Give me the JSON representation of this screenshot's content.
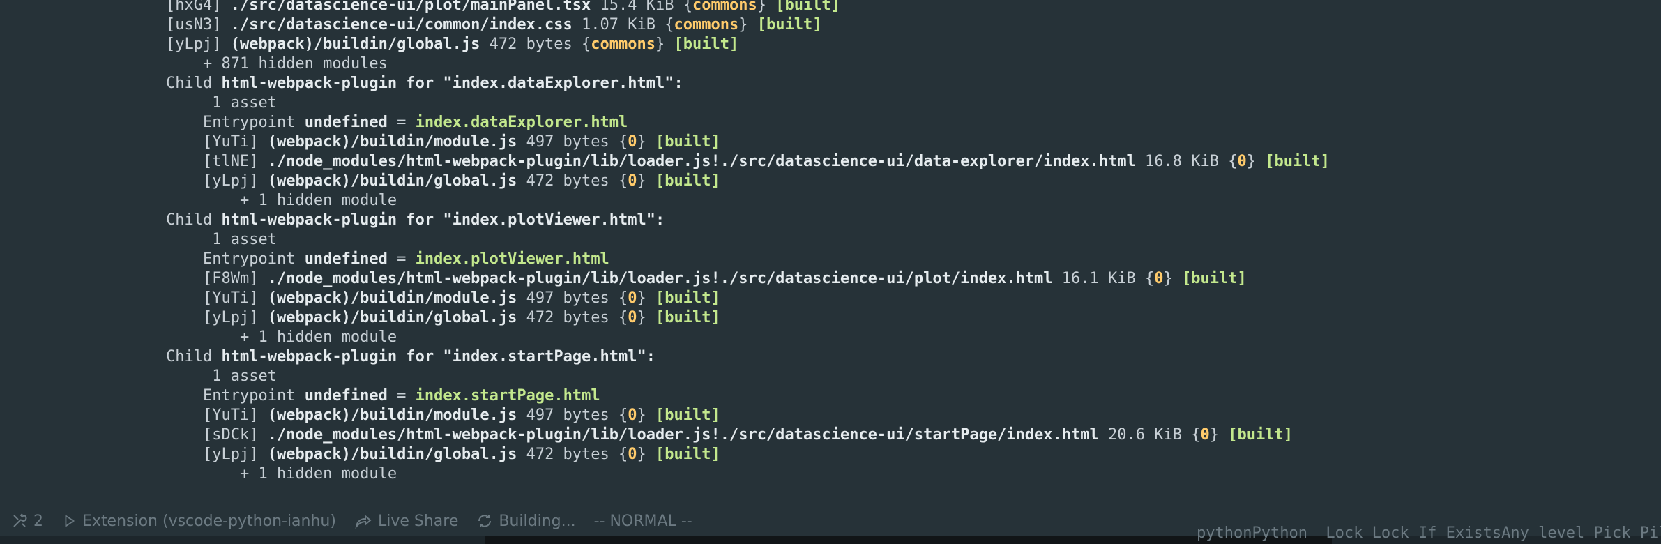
{
  "terminal": {
    "lines": [
      [
        {
          "t": "[hxG4] "
        },
        {
          "t": "./src/datascience-ui/plot/mainPanel.tsx",
          "s": "b"
        },
        {
          "t": " 15.4 KiB {"
        },
        {
          "t": "commons",
          "s": "y"
        },
        {
          "t": "} "
        },
        {
          "t": "[built]",
          "s": "g"
        }
      ],
      [
        {
          "t": "[usN3] "
        },
        {
          "t": "./src/datascience-ui/common/index.css",
          "s": "b"
        },
        {
          "t": " 1.07 KiB {"
        },
        {
          "t": "commons",
          "s": "y"
        },
        {
          "t": "} "
        },
        {
          "t": "[built]",
          "s": "g"
        }
      ],
      [
        {
          "t": "[yLpj] "
        },
        {
          "t": "(webpack)/buildin/global.js",
          "s": "b"
        },
        {
          "t": " 472 bytes {"
        },
        {
          "t": "commons",
          "s": "y"
        },
        {
          "t": "} "
        },
        {
          "t": "[built]",
          "s": "g"
        }
      ],
      [
        {
          "t": "    + 871 hidden modules"
        }
      ],
      [
        {
          "t": "Child "
        },
        {
          "t": "html-webpack-plugin",
          "s": "b"
        },
        {
          "t": " for \"index.dataExplorer.html\":",
          "s": "b"
        }
      ],
      [
        {
          "t": "     1 asset"
        }
      ],
      [
        {
          "t": "    Entrypoint "
        },
        {
          "t": "undefined",
          "s": "b"
        },
        {
          "t": " = "
        },
        {
          "t": "index.dataExplorer.html",
          "s": "g"
        }
      ],
      [
        {
          "t": "    [YuTi] "
        },
        {
          "t": "(webpack)/buildin/module.js",
          "s": "b"
        },
        {
          "t": " 497 bytes {"
        },
        {
          "t": "0",
          "s": "y"
        },
        {
          "t": "} "
        },
        {
          "t": "[built]",
          "s": "g"
        }
      ],
      [
        {
          "t": "    [tlNE] "
        },
        {
          "t": "./node_modules/html-webpack-plugin/lib/loader.js!./src/datascience-ui/data-explorer/index.html",
          "s": "b"
        },
        {
          "t": " 16.8 KiB {"
        },
        {
          "t": "0",
          "s": "y"
        },
        {
          "t": "} "
        },
        {
          "t": "[built]",
          "s": "g"
        }
      ],
      [
        {
          "t": "    [yLpj] "
        },
        {
          "t": "(webpack)/buildin/global.js",
          "s": "b"
        },
        {
          "t": " 472 bytes {"
        },
        {
          "t": "0",
          "s": "y"
        },
        {
          "t": "} "
        },
        {
          "t": "[built]",
          "s": "g"
        }
      ],
      [
        {
          "t": "        + 1 hidden module"
        }
      ],
      [
        {
          "t": "Child "
        },
        {
          "t": "html-webpack-plugin",
          "s": "b"
        },
        {
          "t": " for \"index.plotViewer.html\":",
          "s": "b"
        }
      ],
      [
        {
          "t": "     1 asset"
        }
      ],
      [
        {
          "t": "    Entrypoint "
        },
        {
          "t": "undefined",
          "s": "b"
        },
        {
          "t": " = "
        },
        {
          "t": "index.plotViewer.html",
          "s": "g"
        }
      ],
      [
        {
          "t": "    [F8Wm] "
        },
        {
          "t": "./node_modules/html-webpack-plugin/lib/loader.js!./src/datascience-ui/plot/index.html",
          "s": "b"
        },
        {
          "t": " 16.1 KiB {"
        },
        {
          "t": "0",
          "s": "y"
        },
        {
          "t": "} "
        },
        {
          "t": "[built]",
          "s": "g"
        }
      ],
      [
        {
          "t": "    [YuTi] "
        },
        {
          "t": "(webpack)/buildin/module.js",
          "s": "b"
        },
        {
          "t": " 497 bytes {"
        },
        {
          "t": "0",
          "s": "y"
        },
        {
          "t": "} "
        },
        {
          "t": "[built]",
          "s": "g"
        }
      ],
      [
        {
          "t": "    [yLpj] "
        },
        {
          "t": "(webpack)/buildin/global.js",
          "s": "b"
        },
        {
          "t": " 472 bytes {"
        },
        {
          "t": "0",
          "s": "y"
        },
        {
          "t": "} "
        },
        {
          "t": "[built]",
          "s": "g"
        }
      ],
      [
        {
          "t": "        + 1 hidden module"
        }
      ],
      [
        {
          "t": "Child "
        },
        {
          "t": "html-webpack-plugin",
          "s": "b"
        },
        {
          "t": " for \"index.startPage.html\":",
          "s": "b"
        }
      ],
      [
        {
          "t": "     1 asset"
        }
      ],
      [
        {
          "t": "    Entrypoint "
        },
        {
          "t": "undefined",
          "s": "b"
        },
        {
          "t": " = "
        },
        {
          "t": "index.startPage.html",
          "s": "g"
        }
      ],
      [
        {
          "t": "    [YuTi] "
        },
        {
          "t": "(webpack)/buildin/module.js",
          "s": "b"
        },
        {
          "t": " 497 bytes {"
        },
        {
          "t": "0",
          "s": "y"
        },
        {
          "t": "} "
        },
        {
          "t": "[built]",
          "s": "g"
        }
      ],
      [
        {
          "t": "    [sDCk] "
        },
        {
          "t": "./node_modules/html-webpack-plugin/lib/loader.js!./src/datascience-ui/startPage/index.html",
          "s": "b"
        },
        {
          "t": " 20.6 KiB {"
        },
        {
          "t": "0",
          "s": "y"
        },
        {
          "t": "} "
        },
        {
          "t": "[built]",
          "s": "g"
        }
      ],
      [
        {
          "t": "    [yLpj] "
        },
        {
          "t": "(webpack)/buildin/global.js",
          "s": "b"
        },
        {
          "t": " 472 bytes {"
        },
        {
          "t": "0",
          "s": "y"
        },
        {
          "t": "} "
        },
        {
          "t": "[built]",
          "s": "g"
        }
      ],
      [
        {
          "t": "        + 1 hidden module"
        }
      ]
    ]
  },
  "statusbar": {
    "ports_icon": "tools-icon",
    "ports_count": "2",
    "launch_icon": "play-icon",
    "launch_label": "Extension (vscode-python-ianhu)",
    "liveshare_icon": "live-share-icon",
    "liveshare_label": "Live Share",
    "build_icon": "sync-icon",
    "build_label": "Building...",
    "vim_mode": "-- NORMAL --"
  },
  "bottom_panel": {
    "text": "pythonPython  Lock Lock If ExistsAny level Pick Pile"
  },
  "colors": {
    "background": "#263238",
    "default_text": "#c8d0d6",
    "bold_text": "#e6ecef",
    "built_green": "#c3e88d",
    "chunk_yellow": "#ffcb6b",
    "statusbar_text": "#6c7a82"
  }
}
